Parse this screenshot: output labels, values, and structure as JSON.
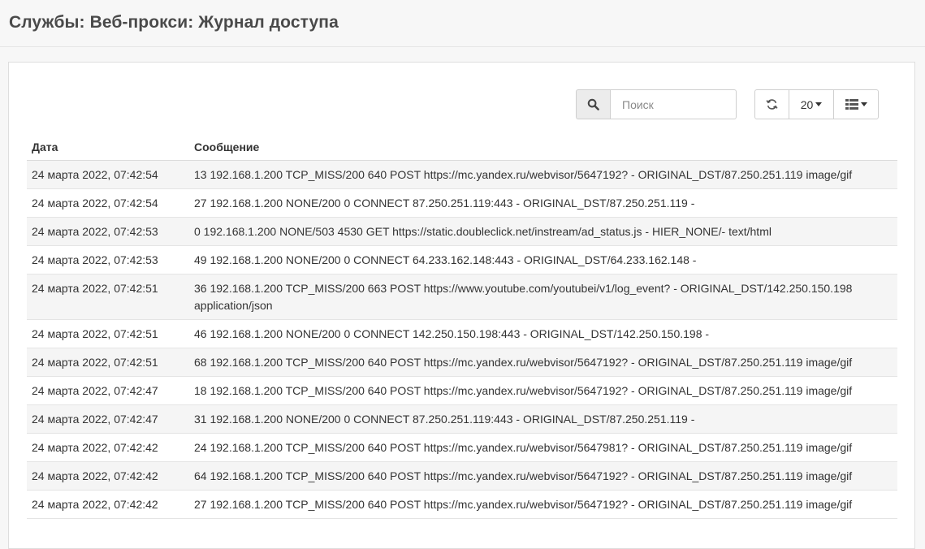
{
  "page": {
    "title": "Службы: Веб-прокси: Журнал доступа"
  },
  "toolbar": {
    "search_icon": "search-icon",
    "search_placeholder": "Поиск",
    "search_value": "",
    "refresh_icon": "refresh-icon",
    "rows_per_page": "20",
    "columns_icon": "list-columns-icon"
  },
  "table": {
    "headers": {
      "date": "Дата",
      "message": "Сообщение"
    },
    "rows": [
      {
        "date": "24 марта 2022, 07:42:54",
        "message": "13 192.168.1.200 TCP_MISS/200 640 POST https://mc.yandex.ru/webvisor/5647192? - ORIGINAL_DST/87.250.251.119 image/gif"
      },
      {
        "date": "24 марта 2022, 07:42:54",
        "message": "27 192.168.1.200 NONE/200 0 CONNECT 87.250.251.119:443 - ORIGINAL_DST/87.250.251.119 -"
      },
      {
        "date": "24 марта 2022, 07:42:53",
        "message": "0 192.168.1.200 NONE/503 4530 GET https://static.doubleclick.net/instream/ad_status.js - HIER_NONE/- text/html"
      },
      {
        "date": "24 марта 2022, 07:42:53",
        "message": "49 192.168.1.200 NONE/200 0 CONNECT 64.233.162.148:443 - ORIGINAL_DST/64.233.162.148 -"
      },
      {
        "date": "24 марта 2022, 07:42:51",
        "message": "36 192.168.1.200 TCP_MISS/200 663 POST https://www.youtube.com/youtubei/v1/log_event? - ORIGINAL_DST/142.250.150.198 application/json"
      },
      {
        "date": "24 марта 2022, 07:42:51",
        "message": "46 192.168.1.200 NONE/200 0 CONNECT 142.250.150.198:443 - ORIGINAL_DST/142.250.150.198 -"
      },
      {
        "date": "24 марта 2022, 07:42:51",
        "message": "68 192.168.1.200 TCP_MISS/200 640 POST https://mc.yandex.ru/webvisor/5647192? - ORIGINAL_DST/87.250.251.119 image/gif"
      },
      {
        "date": "24 марта 2022, 07:42:47",
        "message": "18 192.168.1.200 TCP_MISS/200 640 POST https://mc.yandex.ru/webvisor/5647192? - ORIGINAL_DST/87.250.251.119 image/gif"
      },
      {
        "date": "24 марта 2022, 07:42:47",
        "message": "31 192.168.1.200 NONE/200 0 CONNECT 87.250.251.119:443 - ORIGINAL_DST/87.250.251.119 -"
      },
      {
        "date": "24 марта 2022, 07:42:42",
        "message": "24 192.168.1.200 TCP_MISS/200 640 POST https://mc.yandex.ru/webvisor/5647981? - ORIGINAL_DST/87.250.251.119 image/gif"
      },
      {
        "date": "24 марта 2022, 07:42:42",
        "message": "64 192.168.1.200 TCP_MISS/200 640 POST https://mc.yandex.ru/webvisor/5647192? - ORIGINAL_DST/87.250.251.119 image/gif"
      },
      {
        "date": "24 марта 2022, 07:42:42",
        "message": "27 192.168.1.200 TCP_MISS/200 640 POST https://mc.yandex.ru/webvisor/5647192? - ORIGINAL_DST/87.250.251.119 image/gif"
      }
    ]
  }
}
